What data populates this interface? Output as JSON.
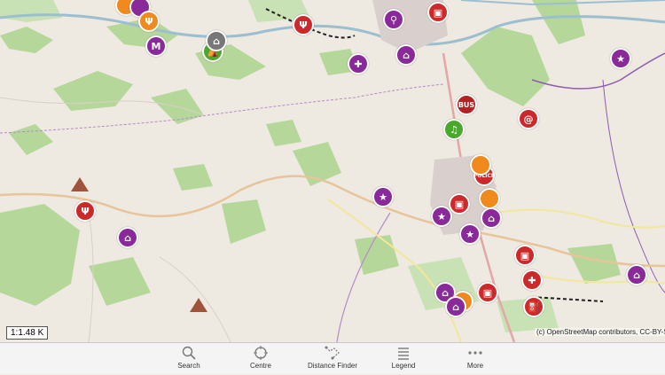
{
  "map": {
    "scale_label": "1:1.48 K",
    "attribution": "(c) OpenStreetMap contributors, CC-BY-SA",
    "markers": [
      {
        "name": "purple-star-poi-1",
        "color": "purple",
        "glyph": "★"
      },
      {
        "name": "purple-star-poi-2",
        "color": "purple",
        "glyph": "★"
      },
      {
        "name": "purple-star-poi-3",
        "color": "purple",
        "glyph": "★"
      },
      {
        "name": "purple-church-poi-1",
        "color": "purple",
        "glyph": "⌂"
      },
      {
        "name": "purple-church-poi-2",
        "color": "purple",
        "glyph": "⌂"
      },
      {
        "name": "metro-poi",
        "color": "purple",
        "glyph": "M"
      },
      {
        "name": "bus-poi",
        "color": "dkred",
        "glyph": "BUS"
      },
      {
        "name": "email-poi",
        "color": "red",
        "glyph": "@"
      },
      {
        "name": "police-poi",
        "color": "red",
        "glyph": "POLICE"
      },
      {
        "name": "music-poi",
        "color": "green",
        "glyph": "♫"
      },
      {
        "name": "restaurant-poi",
        "color": "orange",
        "glyph": "Ψ"
      }
    ]
  },
  "toolbar": {
    "search_label": "Search",
    "centre_label": "Centre",
    "distance_label": "Distance Finder",
    "legend_label": "Legend",
    "more_label": "More"
  },
  "colors": {
    "map_background": "#eee9e1",
    "woodland": "#a9d28a",
    "road_yellow": "#f3eea0",
    "river": "#aac4cf",
    "boundary": "#a070b8"
  }
}
